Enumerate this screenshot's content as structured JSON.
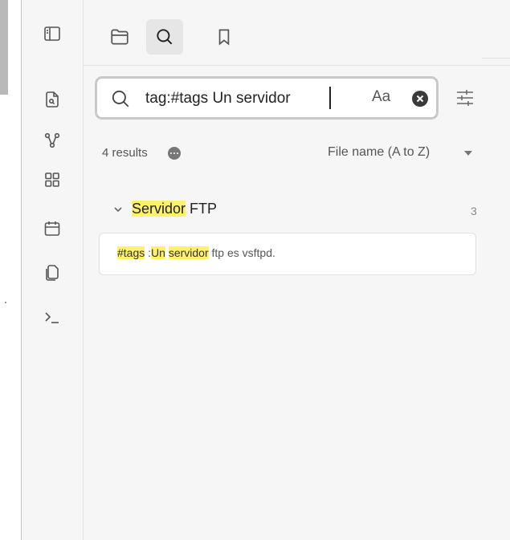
{
  "search": {
    "query": "tag:#tags Un servidor",
    "match_case_label": "Aa"
  },
  "results": {
    "count_label": "4 results",
    "sort_label": "File name (A to Z)"
  },
  "file": {
    "title_highlight": "Servidor",
    "title_rest": " FTP",
    "match_count": "3"
  },
  "match": {
    "seg1": "#tags",
    "seg2": " :",
    "seg3": "Un",
    "seg4": " ",
    "seg5": "servidor",
    "seg6": " ftp es vsftpd."
  },
  "colors": {
    "highlight": "#fff16a",
    "pane_bg": "#f6f6f6",
    "search_border": "#c9c9c9"
  },
  "icons": {
    "ribbon": [
      "sidebar-toggle-icon",
      "open-quick-switcher-icon",
      "graph-view-icon",
      "canvas-icon",
      "daily-note-icon",
      "templates-icon",
      "command-palette-icon"
    ],
    "tabs": [
      "files-icon",
      "search-icon",
      "bookmarks-icon"
    ]
  }
}
